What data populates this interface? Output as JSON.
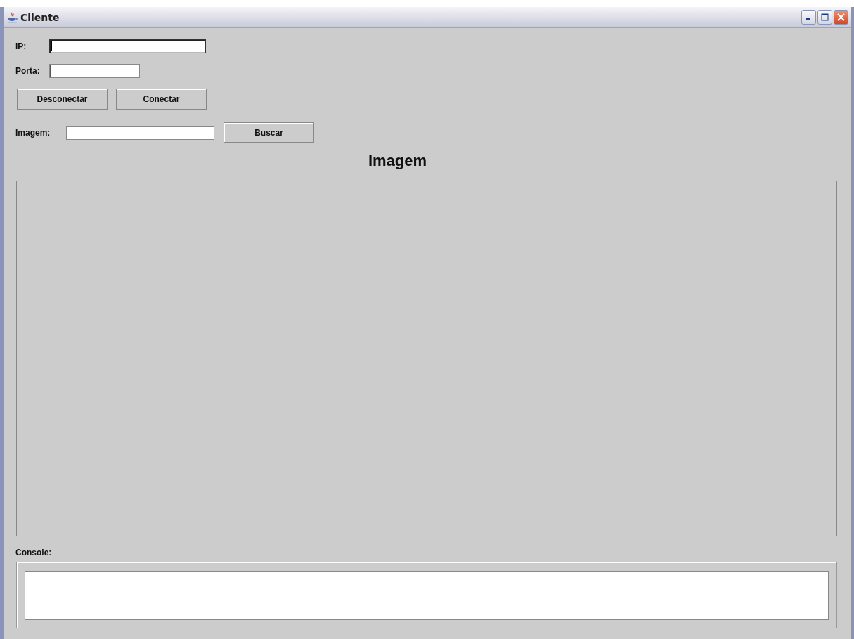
{
  "window": {
    "title": "Cliente"
  },
  "fields": [
    {
      "label": "IP:",
      "focused": true,
      "kind": "wide"
    },
    {
      "label": "Porta:",
      "focused": false,
      "kind": "short"
    }
  ],
  "buttons": [
    "Desconectar",
    "Conectar"
  ],
  "image_row": {
    "label": "Imagem:",
    "button": "Buscar"
  },
  "image_heading": "Imagem",
  "console": {
    "label": "Console:"
  }
}
